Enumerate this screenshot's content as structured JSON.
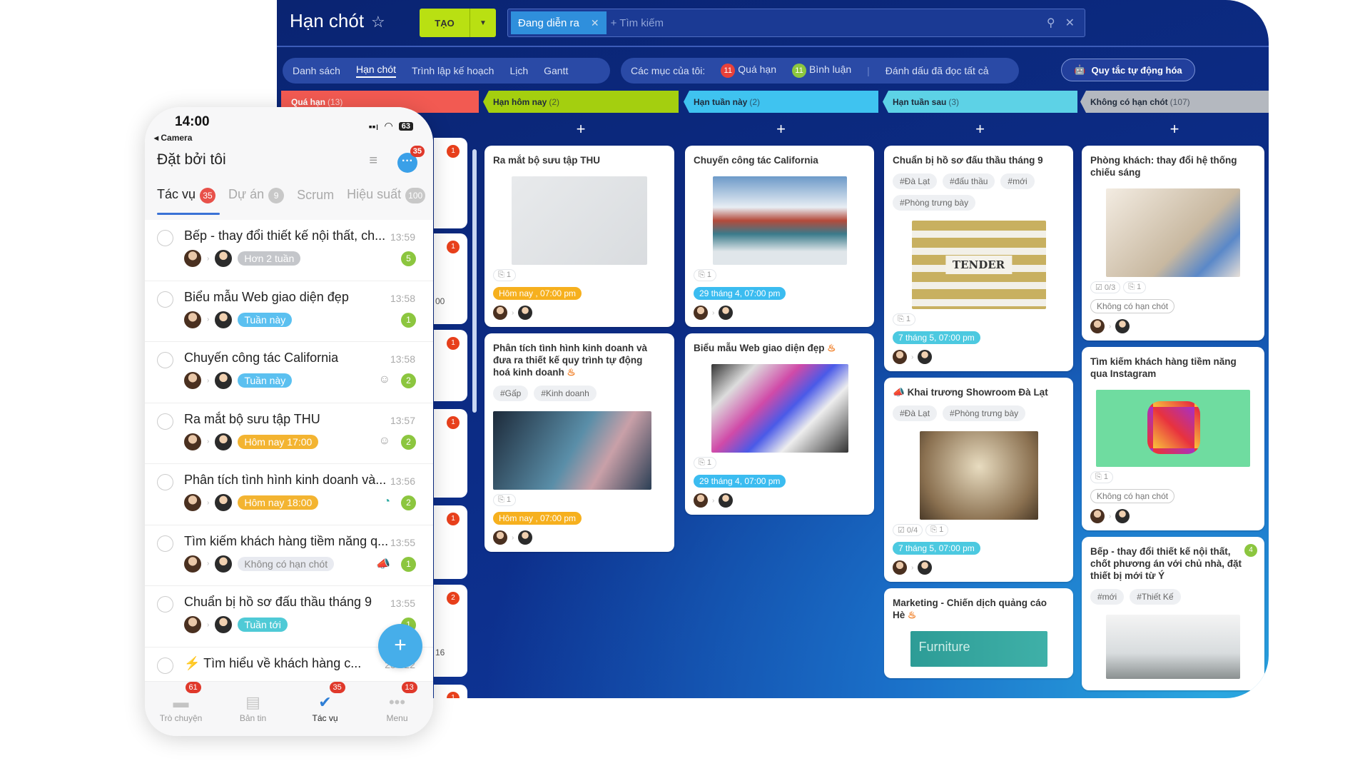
{
  "app": {
    "title": "Hạn chót",
    "create_label": "TẠO",
    "search_chip": "Đang diễn ra",
    "search_placeholder": "+ Tìm kiếm"
  },
  "views": [
    {
      "label": "Danh sách"
    },
    {
      "label": "Hạn chót",
      "active": true
    },
    {
      "label": "Trình lập kế hoạch"
    },
    {
      "label": "Lịch"
    },
    {
      "label": "Gantt"
    }
  ],
  "my_items": {
    "label": "Các mục của tôi:",
    "overdue_count": "11",
    "overdue_label": "Quá hạn",
    "comments_count": "11",
    "comments_label": "Bình luận",
    "mark_read": "Đánh dấu đã đọc tất cả"
  },
  "automation_label": "Quy tắc tự động hóa",
  "colors": {
    "overdue": "#f25a52",
    "today": "#a4cf0f",
    "this_week": "#3fc3f0",
    "next_week": "#5dd2e6",
    "none": "#b4b8bf",
    "bg": "#0c2c86"
  },
  "columns": [
    {
      "name": "Quá hạn",
      "count": "(13)",
      "fragments": [
        "00",
        "16"
      ],
      "badges": [
        "1",
        "1",
        "1",
        "1",
        "1",
        "2",
        "1"
      ]
    },
    {
      "name": "Hạn hôm nay",
      "count": "(2)",
      "cards": [
        {
          "title": "Ra mắt bộ sưu tập THU",
          "image": "furniture-collection",
          "attach": "1",
          "date": "Hôm nay , 07:00 pm",
          "date_color": "#f6b01e"
        },
        {
          "title": "Phân tích tình hình kinh doanh và đưa ra thiết kế quy trình tự động hoá kinh doanh",
          "fire": true,
          "tags": [
            "#Gấp",
            "#Kinh doanh"
          ],
          "image": "business-analytics",
          "attach": "1",
          "date": "Hôm nay , 07:00 pm",
          "date_color": "#f6b01e"
        }
      ]
    },
    {
      "name": "Hạn tuần này",
      "count": "(2)",
      "cards": [
        {
          "title": "Chuyến công tác California",
          "image": "golden-gate-bridge",
          "attach": "1",
          "date": "29 tháng 4, 07:00 pm",
          "date_color": "#3bbcf0"
        },
        {
          "title": "Biểu mẫu Web giao diện đẹp",
          "fire": true,
          "image": "web-templates",
          "attach": "1",
          "date": "29 tháng 4, 07:00 pm",
          "date_color": "#3bbcf0"
        }
      ]
    },
    {
      "name": "Hạn tuần sau",
      "count": "(3)",
      "cards": [
        {
          "title": "Chuẩn bị hồ sơ đấu thầu tháng 9",
          "tags": [
            "#Đà Lạt",
            "#đấu thầu",
            "#mới",
            "#Phòng trưng bày"
          ],
          "image": "tender-folders",
          "image_text": "TENDER",
          "attach": "1",
          "date": "7 tháng 5, 07:00 pm",
          "date_color": "#4cc9e0"
        },
        {
          "title": "Khai trương Showroom Đà Lạt",
          "megaphone": true,
          "tags": [
            "#Đà Lạt",
            "#Phòng trưng bày"
          ],
          "image": "showroom",
          "checklist": "0/4",
          "attach": "1",
          "date": "7 tháng 5, 07:00 pm",
          "date_color": "#4cc9e0"
        },
        {
          "title": "Marketing - Chiến dịch quảng cáo Hè",
          "fire": true,
          "image": "furniture-marketing",
          "image_text": "Furniture"
        }
      ]
    },
    {
      "name": "Không có hạn chót",
      "count": "(107)",
      "cards": [
        {
          "title": "Phòng khách: thay đổi hệ thống chiếu sáng",
          "image": "living-room",
          "checklist": "0/3",
          "attach": "1",
          "date": "Không có hạn chót",
          "no_deadline": true
        },
        {
          "title": "Tìm kiếm khách hàng tiềm năng qua Instagram",
          "image": "instagram",
          "attach": "1",
          "date": "Không có hạn chót",
          "no_deadline": true
        },
        {
          "title": "Bếp - thay đổi thiết kế nội thất, chốt phương án với chủ nhà, đặt thiết bị mới từ Ý",
          "badge": "4",
          "tags": [
            "#mới",
            "#Thiết Kế"
          ],
          "image": "kitchen"
        }
      ]
    }
  ],
  "phone": {
    "time": "14:00",
    "back": "◂ Camera",
    "battery": "63",
    "title": "Đặt bởi tôi",
    "notif": "35",
    "tabs": [
      {
        "label": "Tác vụ",
        "count": "35",
        "active": true
      },
      {
        "label": "Dự án",
        "count": "9"
      },
      {
        "label": "Scrum"
      },
      {
        "label": "Hiệu suất",
        "count": "100"
      }
    ],
    "rows": [
      {
        "title": "Bếp - thay đổi thiết kế nội thất, ch...",
        "time": "13:59",
        "tag": "Hơn 2 tuần",
        "tag_color": "#c4c6ca",
        "count": "5"
      },
      {
        "title": "Biểu mẫu Web giao diện đẹp",
        "time": "13:58",
        "tag": "Tuần này",
        "tag_color": "#5bc0f0",
        "count": "1"
      },
      {
        "title": "Chuyến công tác California",
        "time": "13:58",
        "tag": "Tuần này",
        "tag_color": "#5bc0f0",
        "icon": "ghost-icon",
        "count": "2"
      },
      {
        "title": "Ra mắt bộ sưu tập THU",
        "time": "13:57",
        "tag": "Hôm nay 17:00",
        "tag_color": "#f3b431",
        "icon": "ghost-icon",
        "count": "2"
      },
      {
        "title": "Phân tích tình hình kinh doanh và...",
        "time": "13:56",
        "tag": "Hôm nay 18:00",
        "tag_color": "#f3b431",
        "icon": "clock-icon",
        "count": "2"
      },
      {
        "title": "Tìm kiếm khách hàng tiềm năng q...",
        "time": "13:55",
        "tag": "Không có hạn chót",
        "tag_color": "#e8eaf0",
        "icon": "megaphone-icon",
        "count": "1"
      },
      {
        "title": "Chuẩn bị hồ sơ đấu thầu tháng 9",
        "time": "13:55",
        "tag": "Tuần tới",
        "tag_color": "#4fcad6",
        "count": "1"
      },
      {
        "title": "⚡ Tìm hiểu về khách hàng c...",
        "time": "25      022"
      }
    ],
    "nav": [
      {
        "label": "Trò chuyện",
        "count": "61",
        "icon": "chat-icon"
      },
      {
        "label": "Bản tin",
        "icon": "news-icon"
      },
      {
        "label": "Tác vụ",
        "count": "35",
        "icon": "task-check-icon",
        "active": true
      },
      {
        "label": "Menu",
        "count": "13",
        "icon": "more-icon"
      }
    ]
  }
}
